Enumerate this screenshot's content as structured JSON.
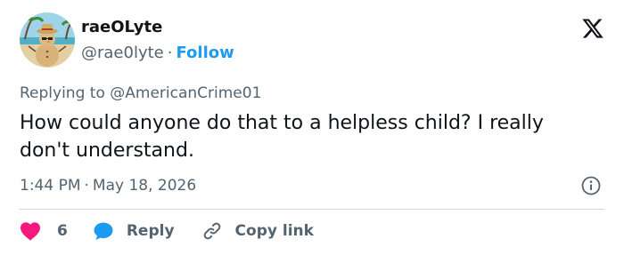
{
  "author": {
    "display_name": "raeOLyte",
    "handle": "@rae0lyte",
    "separator": "·",
    "follow_label": "Follow",
    "avatar_icon": "snowman-beach-avatar"
  },
  "brand": {
    "logo_icon": "x-logo-icon"
  },
  "reply_context": {
    "prefix": "Replying to",
    "mention": "@AmericanCrime01"
  },
  "tweet": {
    "text": "How could anyone do that to a helpless child? I really don't understand.",
    "time": "1:44 PM",
    "separator": "·",
    "date": "May 18, 2026",
    "info_icon": "info-icon"
  },
  "actions": {
    "like_count": "6",
    "reply_label": "Reply",
    "copy_label": "Copy link"
  },
  "colors": {
    "text_primary": "#0f1419",
    "text_secondary": "#536471",
    "accent": "#1d9bf0",
    "like": "#f91880",
    "divider": "#cfd9de"
  }
}
